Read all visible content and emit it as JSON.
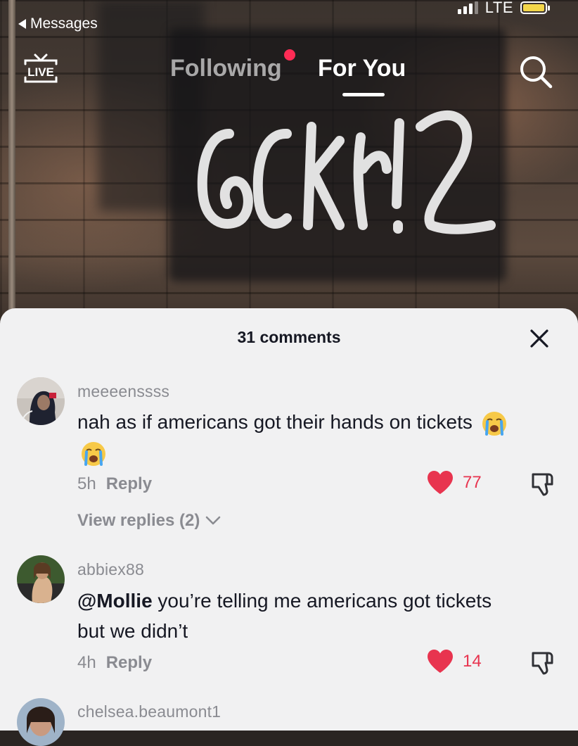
{
  "status_bar": {
    "back_label": "Messages",
    "network": "LTE",
    "battery_color": "#f3d64a"
  },
  "nav": {
    "live_label": "LIVE",
    "tabs": [
      {
        "label": "Following",
        "active": false,
        "has_dot": true
      },
      {
        "label": "For You",
        "active": true
      }
    ],
    "dot_color": "#fe2c55"
  },
  "comments_sheet": {
    "title": "31 comments",
    "comments": [
      {
        "username": "meeeenssss",
        "text": "nah as if americans got their hands on tickets",
        "emoji": "loudly-crying-face",
        "emoji_count": 2,
        "time": "5h",
        "reply_label": "Reply",
        "likes": "77",
        "view_replies": "View replies (2)"
      },
      {
        "username": "abbiex88",
        "mention": "@Mollie",
        "text": "you’re telling me americans got tickets but we didn’t",
        "time": "4h",
        "reply_label": "Reply",
        "likes": "14"
      },
      {
        "username": "chelsea.beaumont1"
      }
    ],
    "like_color": "#e8344f"
  }
}
